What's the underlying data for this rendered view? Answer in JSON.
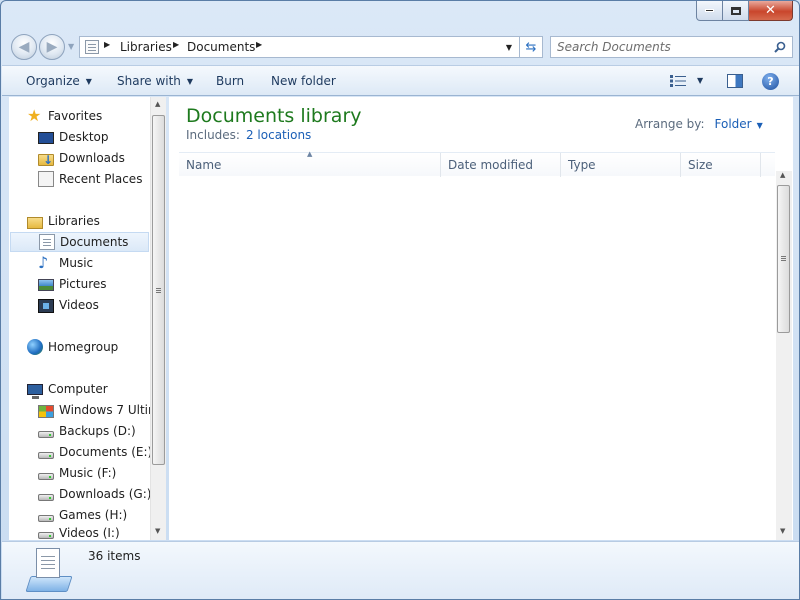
{
  "window": {
    "caption_buttons": [
      "minimize",
      "maximize",
      "close"
    ]
  },
  "navigation": {
    "breadcrumb": [
      "Libraries",
      "Documents"
    ],
    "search_placeholder": "Search Documents"
  },
  "toolbar": {
    "organize": "Organize",
    "share_with": "Share with",
    "burn": "Burn",
    "new_folder": "New folder"
  },
  "sidebar": {
    "favorites": {
      "label": "Favorites",
      "items": [
        "Desktop",
        "Downloads",
        "Recent Places"
      ]
    },
    "libraries": {
      "label": "Libraries",
      "items": [
        "Documents",
        "Music",
        "Pictures",
        "Videos"
      ],
      "selected": "Documents"
    },
    "homegroup": {
      "label": "Homegroup"
    },
    "computer": {
      "label": "Computer",
      "items": [
        "Windows 7 Ultim",
        "Backups (D:)",
        "Documents (E:)",
        "Music (F:)",
        "Downloads (G:)",
        "Games (H:)",
        "Videos (I:)"
      ]
    }
  },
  "content": {
    "title": "Documents library",
    "includes_label": "Includes:",
    "includes_link": "2 locations",
    "arrange_by_label": "Arrange by:",
    "arrange_by_value": "Folder",
    "columns": [
      "Name",
      "Date modified",
      "Type",
      "Size"
    ],
    "sorted_column": "Name"
  },
  "details": {
    "item_count": "36 items"
  },
  "colors": {
    "title_green": "#1e7a1e",
    "link_blue": "#1b5fb6",
    "selection_bg": "#dbe9f8"
  }
}
